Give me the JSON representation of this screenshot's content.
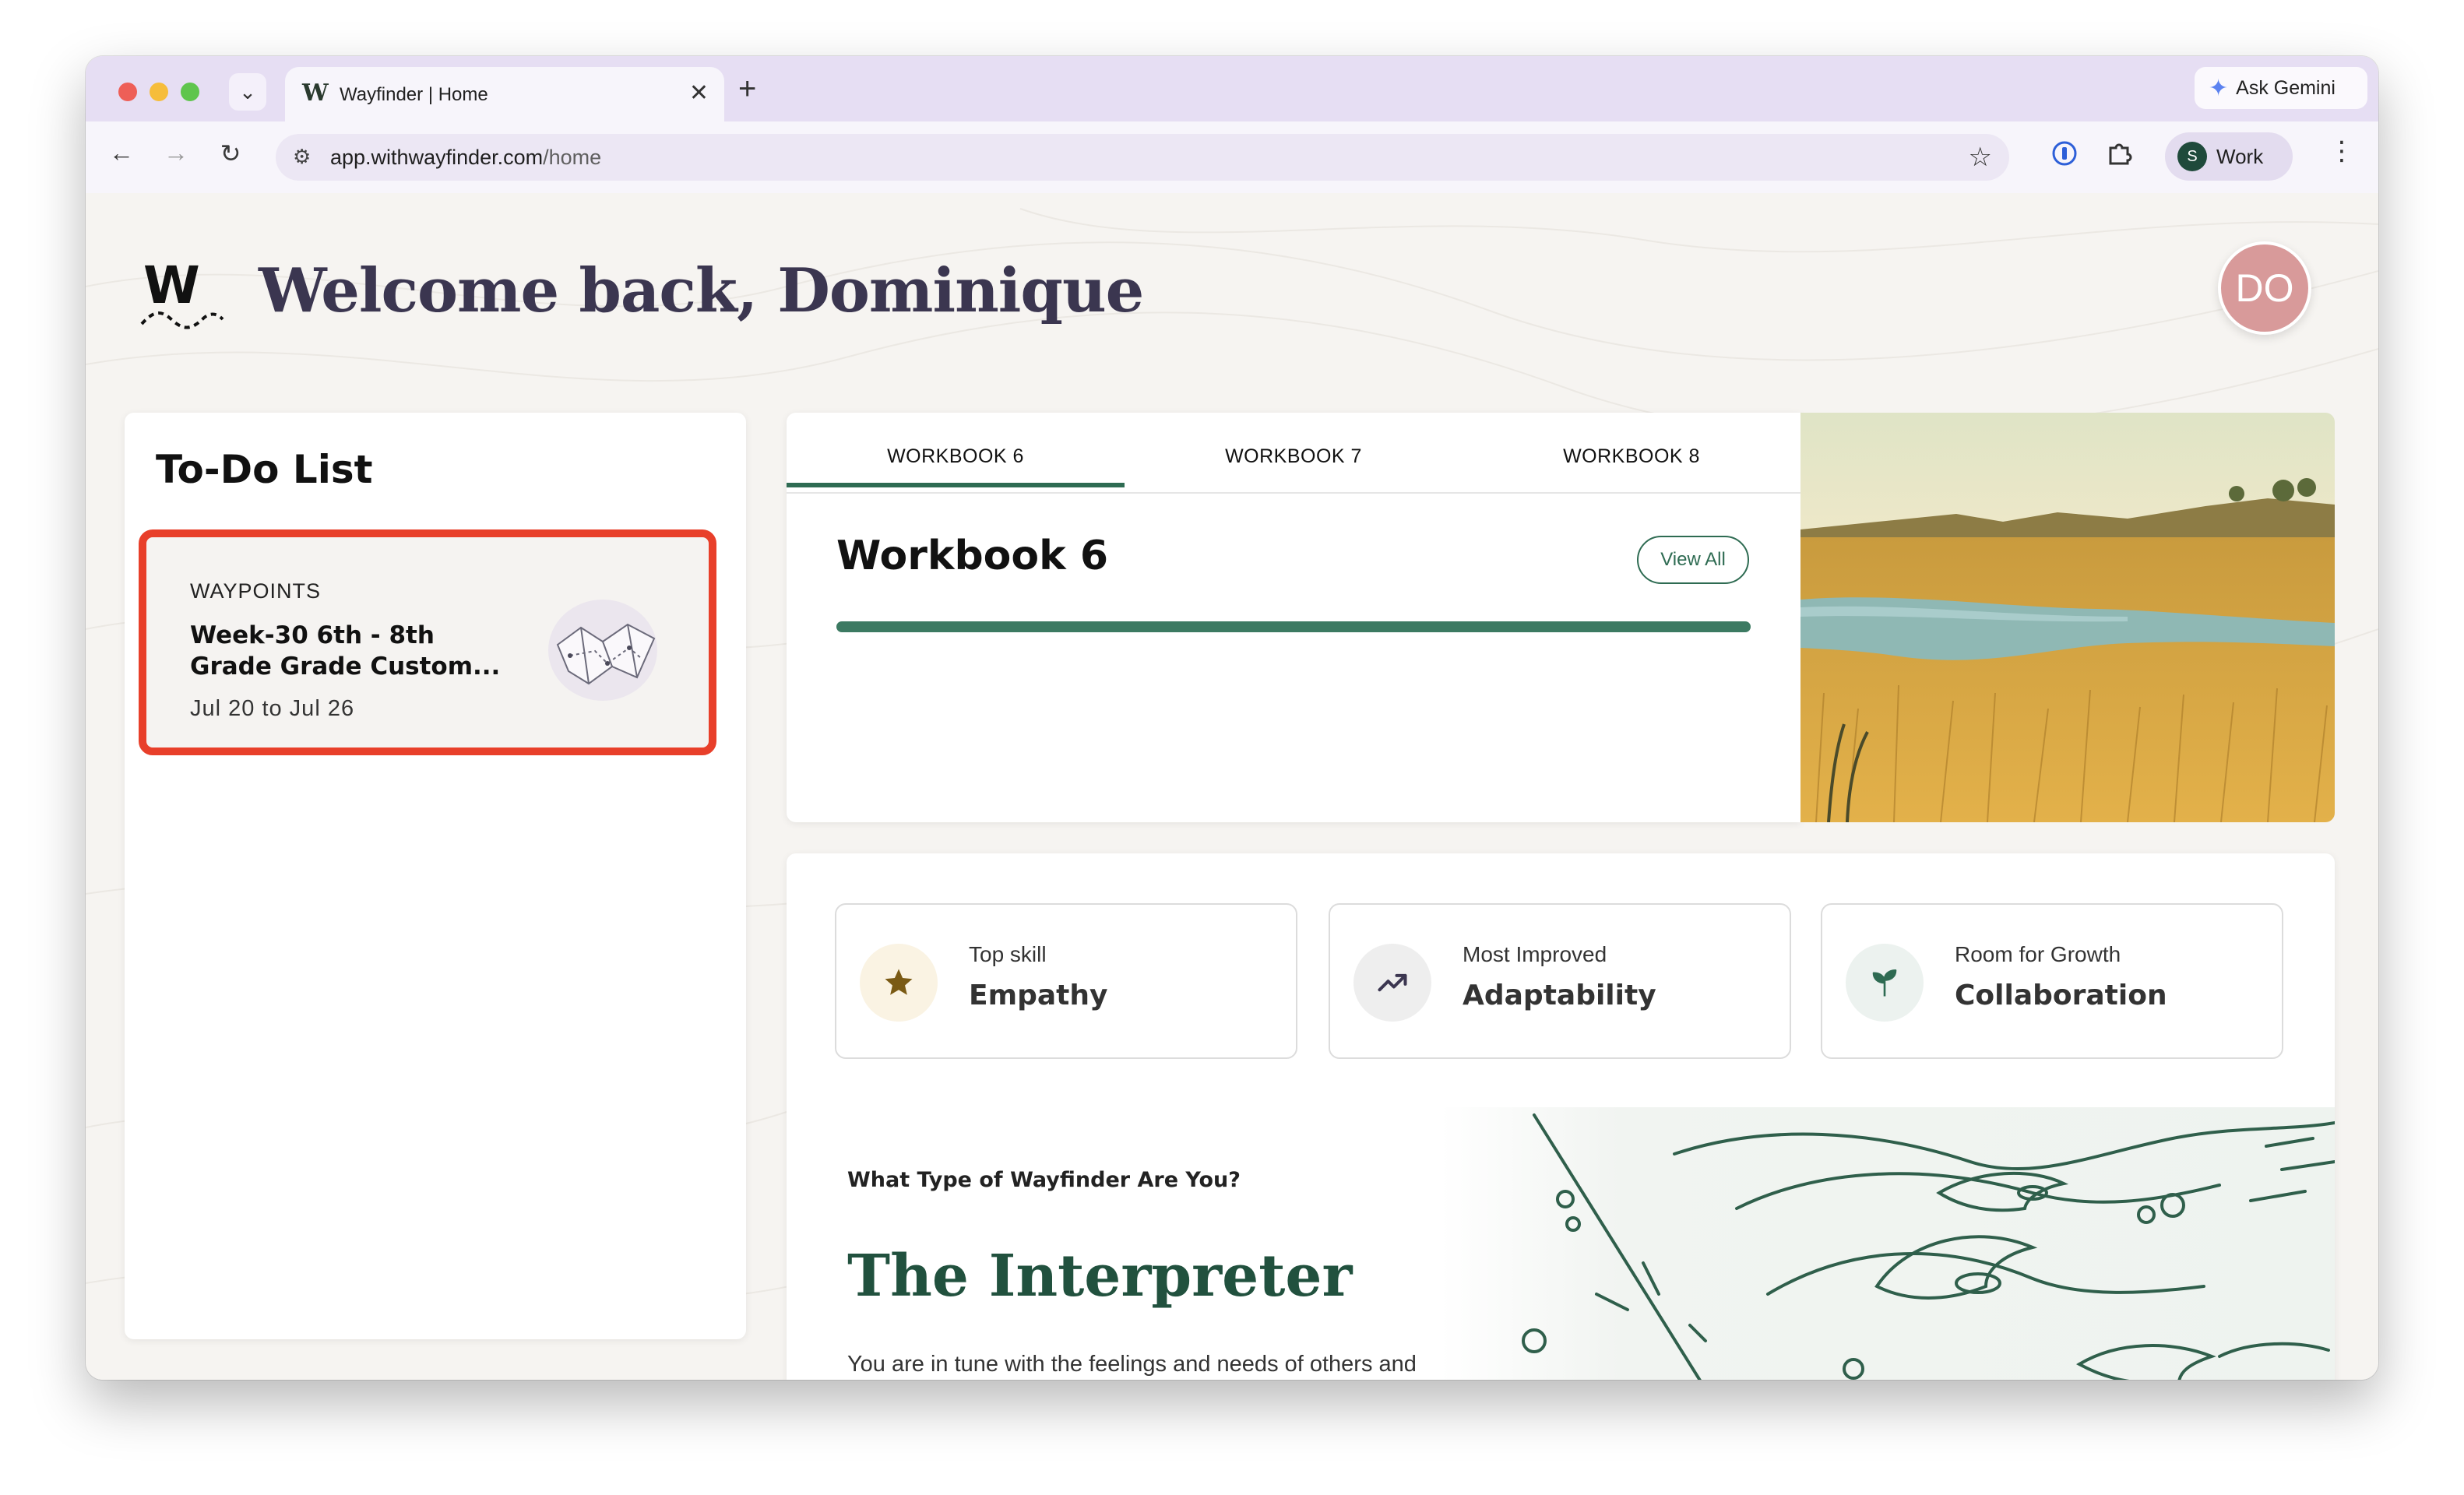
{
  "browser": {
    "tab_title": "Wayfinder | Home",
    "tab_favicon": "W",
    "new_tab_glyph": "+",
    "close_tab_glyph": "✕",
    "ask_gemini": "Ask Gemini",
    "url_domain": "app.withwayfinder.com",
    "url_path": "/home",
    "profile_initial": "S",
    "profile_label": "Work"
  },
  "header": {
    "logo_letter": "W",
    "welcome": "Welcome back, Dominique",
    "avatar_initials": "DO"
  },
  "todo": {
    "title": "To-Do List",
    "items": [
      {
        "category": "WAYPOINTS",
        "title": "Week-30 6th - 8th Grade Grade Custom...",
        "dates": "Jul 20 to Jul 26",
        "icon": "map-icon"
      }
    ]
  },
  "workbooks": {
    "tabs": [
      "WORKBOOK 6",
      "WORKBOOK 7",
      "WORKBOOK 8"
    ],
    "active_tab": 0,
    "heading": "Workbook 6",
    "view_all": "View All",
    "progress": 1.0
  },
  "skills": [
    {
      "label": "Top skill",
      "value": "Empathy",
      "icon": "star-icon",
      "icon_color": "#7a5a14",
      "circle_bg": "#faf3e3"
    },
    {
      "label": "Most Improved",
      "value": "Adaptability",
      "icon": "trending-up-icon",
      "icon_color": "#3b3650",
      "circle_bg": "#eeeeee"
    },
    {
      "label": "Room for Growth",
      "value": "Collaboration",
      "icon": "sprout-icon",
      "icon_color": "#2e6b52",
      "circle_bg": "#ecf2ef"
    }
  ],
  "wayfinder_type": {
    "question": "What Type of Wayfinder Are You?",
    "type": "The Interpreter",
    "description": "You are in tune with the feelings and needs of others and"
  },
  "colors": {
    "accent_green": "#2e6b52",
    "highlight_red": "#e83f2a",
    "avatar_pink": "#d89a9a",
    "heading_purple": "#3b3650"
  }
}
